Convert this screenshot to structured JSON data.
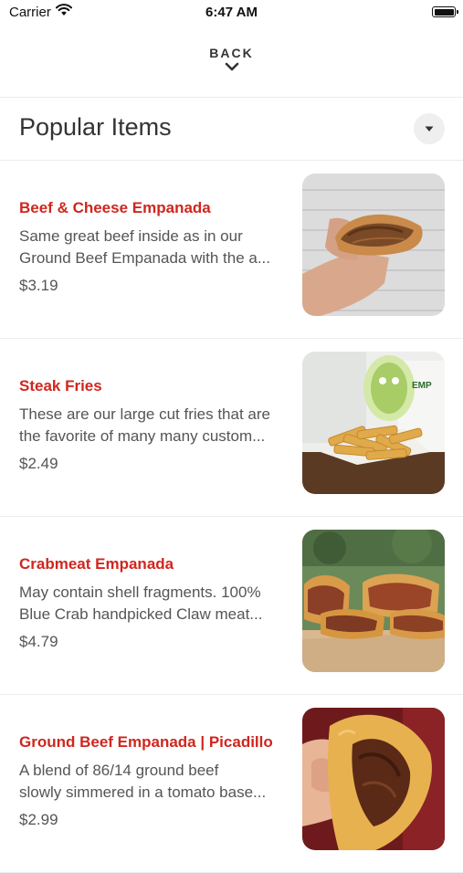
{
  "status_bar": {
    "carrier": "Carrier",
    "time": "6:47 AM"
  },
  "nav": {
    "back_label": "BACK"
  },
  "section": {
    "title": "Popular Items"
  },
  "items": [
    {
      "name": "Beef & Cheese Empanada",
      "desc_line1": "Same great beef inside as in our",
      "desc_line2": "Ground Beef Empanada with the a...",
      "price": "$3.19",
      "image_icon": "beef-cheese-empanada-photo"
    },
    {
      "name": "Steak Fries",
      "desc_line1": "These are our large cut fries that are",
      "desc_line2": "the favorite of many many custom...",
      "price": "$2.49",
      "image_icon": "steak-fries-photo"
    },
    {
      "name": "Crabmeat Empanada",
      "desc_line1": "May contain shell fragments. 100%",
      "desc_line2": "Blue Crab handpicked Claw meat...",
      "price": "$4.79",
      "image_icon": "crabmeat-empanada-photo"
    },
    {
      "name": "Ground Beef Empanada | Picadillo",
      "desc_line1": "A blend of 86/14 ground beef",
      "desc_line2": "slowly simmered in a tomato base...",
      "price": "$2.99",
      "image_icon": "ground-beef-empanada-photo"
    }
  ],
  "colors": {
    "item_name": "#d0261e",
    "text_secondary": "#555555",
    "divider": "#ececec"
  }
}
